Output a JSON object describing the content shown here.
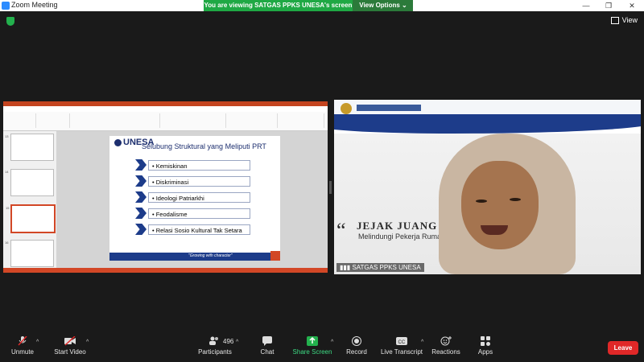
{
  "window": {
    "title": "Zoom Meeting",
    "controls": [
      "—",
      "❐",
      "✕"
    ]
  },
  "share_banner": {
    "message": "You are viewing SATGAS PPKS UNESA's screen",
    "options_label": "View Options",
    "options_caret": "⌄"
  },
  "view_button": {
    "label": "View"
  },
  "shared_screen": {
    "slide": {
      "brand": "UNESA",
      "title": "Selubung Struktural yang Meliputi PRT",
      "items": [
        "Kemiskinan",
        "Diskriminasi",
        "Ideologi Patriarkhi",
        "Feodalisme",
        "Relasi Sosio Kultural Tak Setara"
      ],
      "tagline": "\"Growing with character\""
    },
    "thumbnail_numbers": [
      "13",
      "14",
      "15",
      "16"
    ]
  },
  "speaker_video": {
    "name": "SATGAS PPKS UNESA",
    "backdrop_title": "JEJAK JUANG KAR",
    "backdrop_subtitle": "Melindungi Pekerja Ruma",
    "quote_glyph": "“"
  },
  "toolbar": {
    "unmute": "Unmute",
    "start_video": "Start Video",
    "participants": "Participants",
    "participants_count": "496",
    "chat": "Chat",
    "share_screen": "Share Screen",
    "record": "Record",
    "live_transcript": "Live Transcript",
    "reactions": "Reactions",
    "apps": "Apps",
    "leave": "Leave"
  },
  "colors": {
    "zoom_blue": "#2d8cff",
    "banner_green": "#1fa844",
    "ppt_orange": "#d24726",
    "unesa_navy": "#1d3c8a",
    "leave_red": "#e02828",
    "share_green": "#3ddc84"
  }
}
